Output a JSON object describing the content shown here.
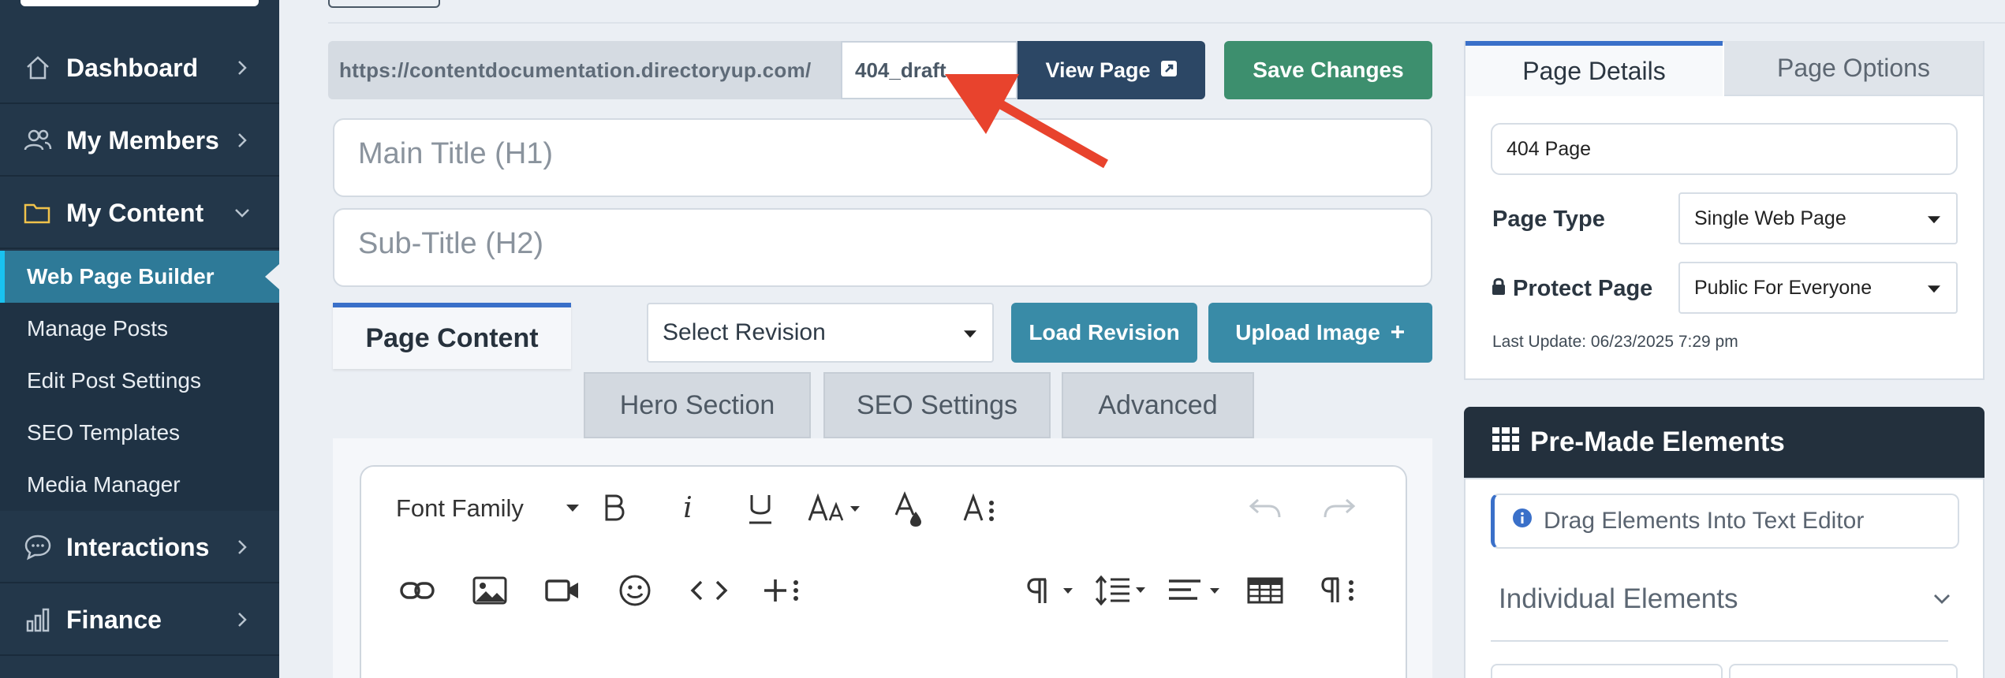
{
  "sidebar": {
    "items": [
      {
        "label": "Dashboard"
      },
      {
        "label": "My Members"
      },
      {
        "label": "My Content"
      },
      {
        "label": "Interactions"
      },
      {
        "label": "Finance"
      }
    ],
    "content_submenu": [
      {
        "label": "Web Page Builder"
      },
      {
        "label": "Manage Posts"
      },
      {
        "label": "Edit Post Settings"
      },
      {
        "label": "SEO Templates"
      },
      {
        "label": "Media Manager"
      }
    ]
  },
  "url_bar": {
    "prefix": "https://contentdocumentation.directoryup.com/",
    "slug_value": "404_draft",
    "view_label": "View Page"
  },
  "save_label": "Save Changes",
  "main_title": {
    "placeholder": "Main Title (H1)"
  },
  "sub_title": {
    "placeholder": "Sub-Title (H2)"
  },
  "content_tabs": {
    "page_content": "Page Content",
    "select_revision": "Select Revision",
    "load_revision": "Load Revision",
    "upload_image": "Upload Image",
    "sub_tabs": [
      "Hero Section",
      "SEO Settings",
      "Advanced"
    ]
  },
  "editor_toolbar": {
    "font_family": "Font Family",
    "italic_glyph": "i"
  },
  "details_panel": {
    "tab_details": "Page Details",
    "tab_options": "Page Options",
    "page_name": "404 Page",
    "page_type_label": "Page Type",
    "page_type_value": "Single Web Page",
    "protect_label": "Protect Page",
    "protect_value": "Public For Everyone",
    "last_update": "Last Update: 06/23/2025 7:29 pm"
  },
  "premade": {
    "title": "Pre-Made Elements",
    "drag_note": "Drag Elements Into Text Editor",
    "individual": "Individual Elements"
  },
  "colors": {
    "sidebar_bg": "#23374a",
    "active_item": "#2e7a98",
    "view_button": "#2c4765",
    "save_button": "#3d8f6e",
    "teal_button": "#398ba7",
    "annotation_arrow": "#e8432d"
  }
}
